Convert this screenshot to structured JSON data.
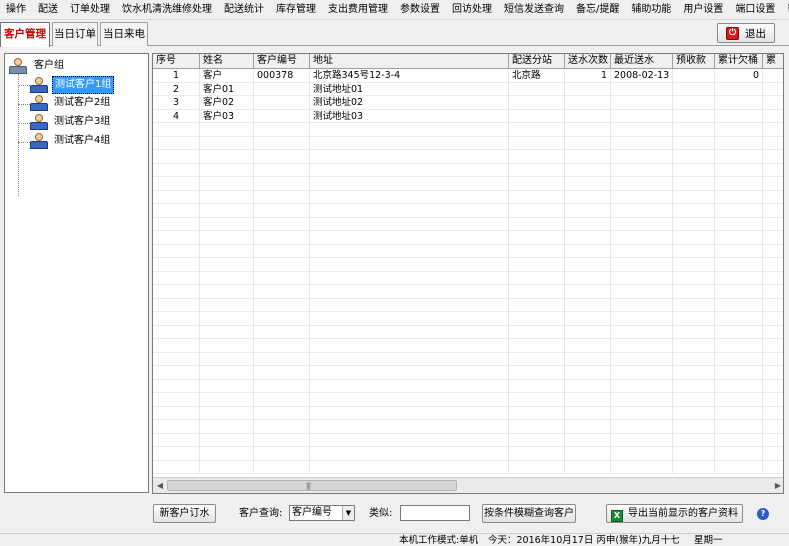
{
  "menu": [
    "操作",
    "配送",
    "订单处理",
    "饮水机清洗维修处理",
    "配送统计",
    "库存管理",
    "支出费用管理",
    "参数设置",
    "回访处理",
    "短信发送查询",
    "备忘/提醒",
    "辅助功能",
    "用户设置",
    "端口设置",
    "帮助"
  ],
  "tabs": [
    "客户管理",
    "当日订单",
    "当日来电"
  ],
  "exit_label": "退出",
  "tree": {
    "root": "客户组",
    "groups": [
      "测试客户1组",
      "测试客户2组",
      "测试客户3组",
      "测试客户4组"
    ],
    "selected_index": 0
  },
  "grid": {
    "columns": [
      "序号",
      "姓名",
      "客户编号",
      "地址",
      "配送分站",
      "送水次数",
      "最近送水",
      "预收款",
      "累计欠桶",
      "累"
    ],
    "rows": [
      [
        "1",
        "客户",
        "000378",
        "北京路345号12-3-4",
        "北京路",
        "1",
        "2008-02-13",
        "",
        "0",
        ""
      ],
      [
        "2",
        "客户01",
        "",
        "测试地址01",
        "",
        "",
        "",
        "",
        "",
        ""
      ],
      [
        "3",
        "客户02",
        "",
        "测试地址02",
        "",
        "",
        "",
        "",
        "",
        ""
      ],
      [
        "4",
        "客户03",
        "",
        "测试地址03",
        "",
        "",
        "",
        "",
        "",
        ""
      ]
    ]
  },
  "toolbar": {
    "new_order": "新客户订水",
    "query_label": "客户查询:",
    "query_field": "客户编号",
    "similar_label": "类似:",
    "similar_value": "",
    "fuzzy_query": "按条件模糊查询客户",
    "export": "导出当前显示的客户资料"
  },
  "status": {
    "mode": "本机工作模式:单机",
    "today": "今天：2016年10月17日 丙申(猴年)九月十七",
    "weekday": "星期一"
  },
  "colors": {
    "active_tab": "#cc0000",
    "selection": "#3399ff"
  }
}
